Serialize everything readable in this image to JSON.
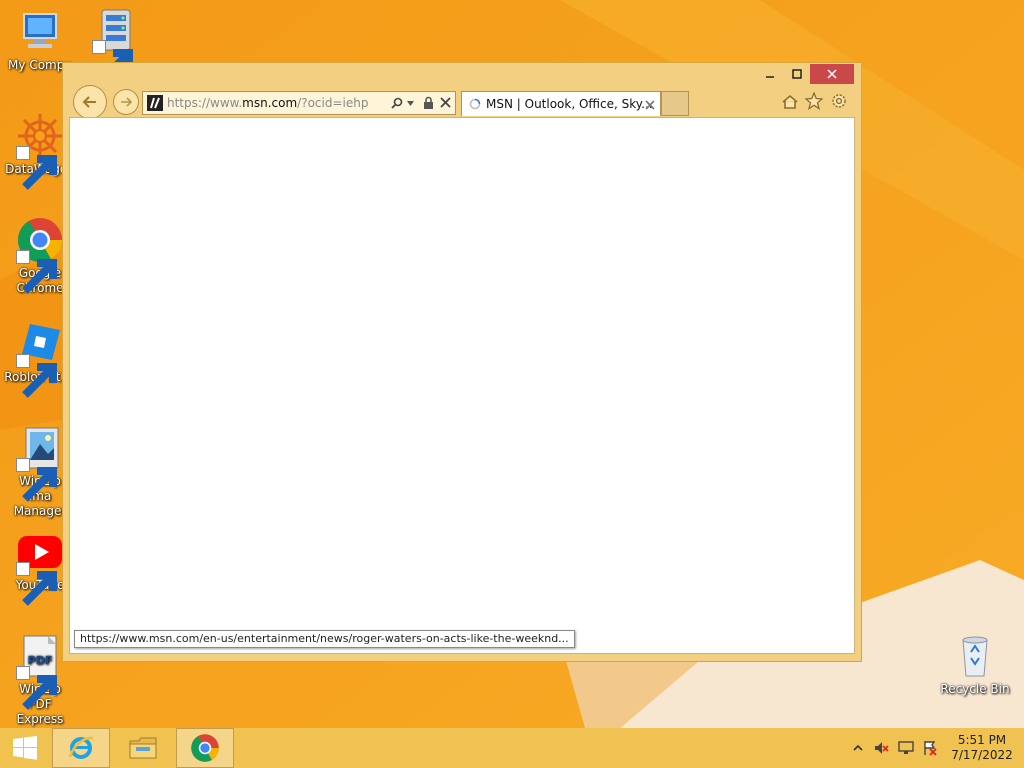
{
  "desktop": {
    "icons": [
      {
        "label": "My Compu",
        "icon": "computer-icon"
      },
      {
        "label": "",
        "icon": "server-icon"
      },
      {
        "label": "DataWagon",
        "icon": "datawagon-icon"
      },
      {
        "label": "Google Chrome",
        "icon": "chrome-icon"
      },
      {
        "label": "Roblox Stud",
        "icon": "roblox-studio-icon"
      },
      {
        "label": "WinZip Ima Manager",
        "icon": "winzip-image-manager-icon"
      },
      {
        "label": "YouTube",
        "icon": "youtube-icon"
      },
      {
        "label": "WinZip PDF Express",
        "icon": "winzip-pdf-icon"
      },
      {
        "label": "Recycle Bin",
        "icon": "recycle-bin-icon"
      }
    ]
  },
  "browser": {
    "address": {
      "prefix": "https://www.",
      "domain": "msn.com",
      "suffix": "/?ocid=iehp"
    },
    "tab": {
      "title": "MSN | Outlook, Office, Sky..."
    },
    "status_url": "https://www.msn.com/en-us/entertainment/news/roger-waters-on-acts-like-the-weeknd..."
  },
  "taskbar": {
    "time": "5:51 PM",
    "date": "7/17/2022"
  },
  "colors": {
    "wallpaper": "#f6a11d",
    "window_frame": "#f3d081",
    "close_button": "#c9494b"
  }
}
